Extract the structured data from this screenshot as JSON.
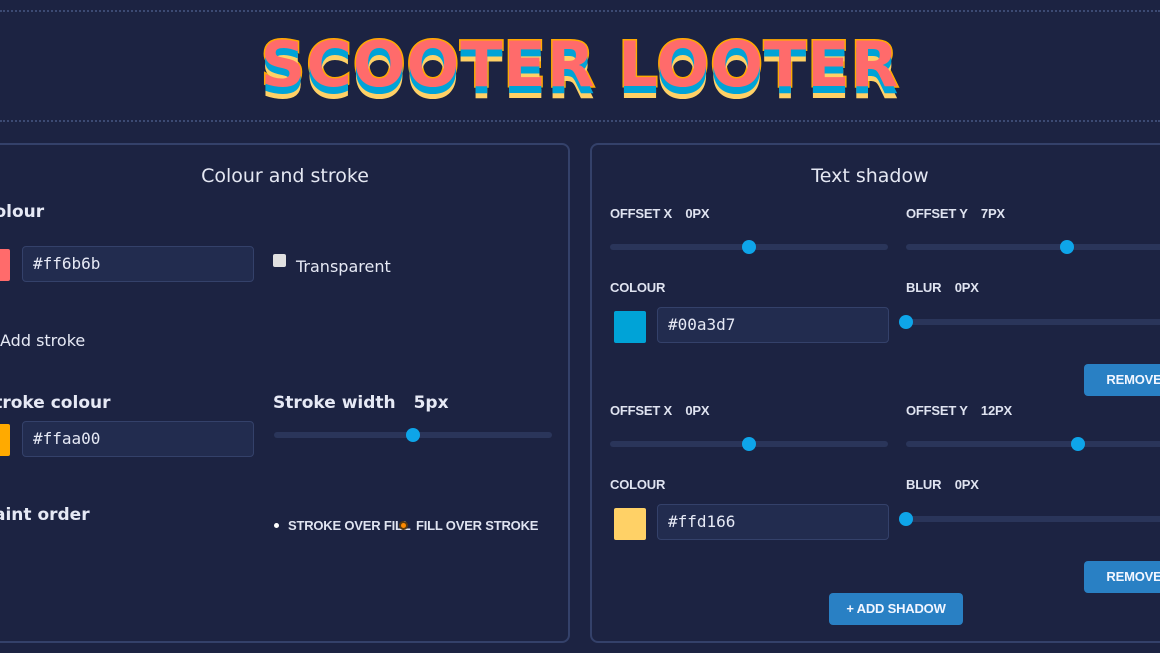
{
  "hero": {
    "title": "SCOOTER LOOTER",
    "fill": "#ff6b6b",
    "stroke_color": "#ffaa00",
    "stroke_width": "5px",
    "shadow_colors": [
      "#00a3d7",
      "#ffd166"
    ]
  },
  "colour_stroke": {
    "title": "Colour and stroke",
    "colour_label": "Colour",
    "colour_value": "#ff6b6b",
    "transparent_label": "Transparent",
    "add_stroke_label": "Add stroke",
    "stroke_colour_label": "Stroke colour",
    "stroke_colour_value": "#ffaa00",
    "stroke_width_label": "Stroke width",
    "stroke_width_value": "5px",
    "stroke_width_level": 0.5,
    "paint_order_label": "Paint order",
    "paint_order_options": [
      "STROKE OVER FILL",
      "FILL OVER STROKE"
    ],
    "paint_order_selected": "FILL OVER STROKE"
  },
  "text_shadow": {
    "title": "Text shadow",
    "shadows": [
      {
        "offset_x_label": "OFFSET X",
        "offset_x_value": "0PX",
        "offset_x_level": 0.5,
        "offset_y_label": "OFFSET Y",
        "offset_y_value": "7PX",
        "offset_y_level": 0.58,
        "colour_label": "COLOUR",
        "colour_value": "#00a3d7",
        "blur_label": "BLUR",
        "blur_value": "0PX",
        "blur_level": 0.0,
        "remove_label": "REMOVE"
      },
      {
        "offset_x_label": "OFFSET X",
        "offset_x_value": "0PX",
        "offset_x_level": 0.5,
        "offset_y_label": "OFFSET Y",
        "offset_y_value": "12PX",
        "offset_y_level": 0.62,
        "colour_label": "COLOUR",
        "colour_value": "#ffd166",
        "blur_label": "BLUR",
        "blur_value": "0PX",
        "blur_level": 0.0,
        "remove_label": "REMOVE"
      }
    ],
    "add_shadow_label": "+ ADD SHADOW"
  }
}
